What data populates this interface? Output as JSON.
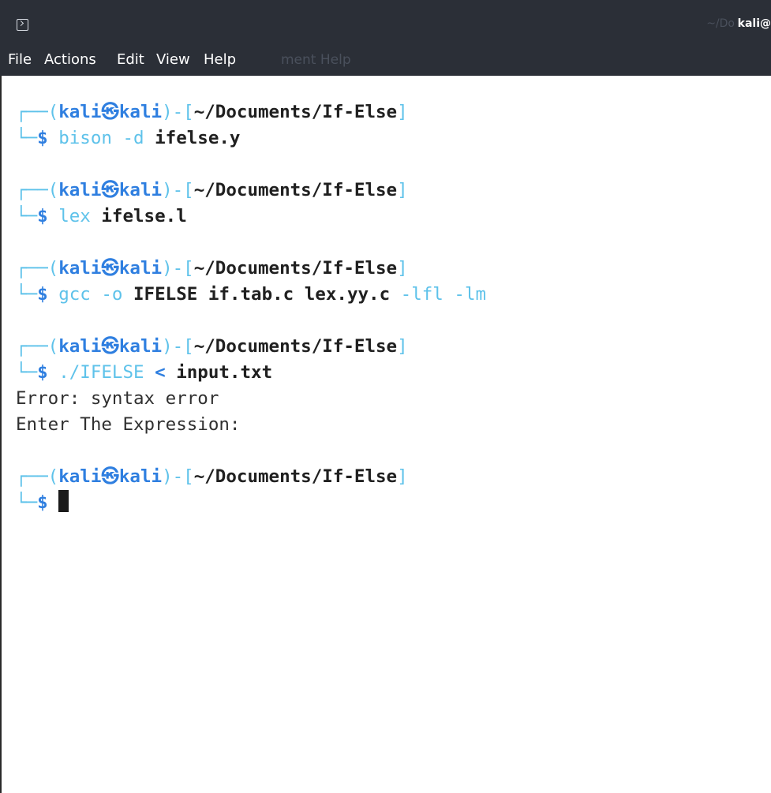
{
  "window": {
    "title": "kali@",
    "title_ghost": "~/Do"
  },
  "menu": {
    "items": [
      "File",
      "Actions",
      "Edit",
      "View",
      "Help"
    ],
    "ghost_text": "ment Help"
  },
  "prompt": {
    "corner_top": "┌──",
    "corner_bottom": "└─",
    "open_paren": "(",
    "user": "kali",
    "at": "㉿",
    "host": "kali",
    "close_paren": ")",
    "dash": "-",
    "open_bracket": "[",
    "cwd": "~/Documents/If-Else",
    "close_bracket": "]",
    "symbol": "$"
  },
  "commands": [
    {
      "parts": [
        {
          "t": "bison",
          "s": "dim"
        },
        {
          "t": " -d ",
          "s": "dim"
        },
        {
          "t": "ifelse.y",
          "s": "bold"
        }
      ],
      "output": []
    },
    {
      "parts": [
        {
          "t": "lex",
          "s": "dim"
        },
        {
          "t": " ",
          "s": "dim"
        },
        {
          "t": "ifelse.l",
          "s": "bold"
        }
      ],
      "output": []
    },
    {
      "parts": [
        {
          "t": "gcc",
          "s": "dim"
        },
        {
          "t": " -o ",
          "s": "dim"
        },
        {
          "t": "IFELSE if.tab.c lex.yy.c",
          "s": "bold"
        },
        {
          "t": " -lfl -lm",
          "s": "dim"
        }
      ],
      "output": []
    },
    {
      "parts": [
        {
          "t": "./IFELSE",
          "s": "dim"
        },
        {
          "t": " < ",
          "s": "dollar"
        },
        {
          "t": "input.txt",
          "s": "bold"
        }
      ],
      "output": [
        "Error: syntax error",
        "Enter The Expression:"
      ]
    }
  ]
}
